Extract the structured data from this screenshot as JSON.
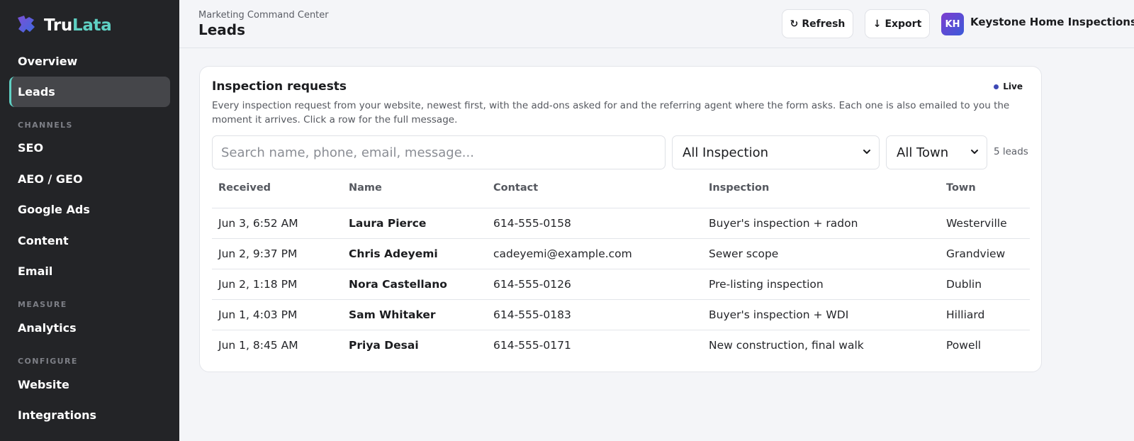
{
  "brand": {
    "name_part1": "Tru",
    "name_part2": "Lata",
    "logo_icon": "puzzle-logo-icon"
  },
  "sidebar": {
    "items_top": [
      {
        "label": "Overview",
        "active": false
      },
      {
        "label": "Leads",
        "active": true
      }
    ],
    "sections": [
      {
        "title": "CHANNELS",
        "items": [
          "SEO",
          "AEO / GEO",
          "Google Ads",
          "Content",
          "Email"
        ]
      },
      {
        "title": "MEASURE",
        "items": [
          "Analytics"
        ]
      },
      {
        "title": "CONFIGURE",
        "items": [
          "Website",
          "Integrations"
        ]
      }
    ]
  },
  "header": {
    "breadcrumb": "Marketing Command Center",
    "title": "Leads",
    "refresh_label": "Refresh",
    "export_label": "Export",
    "refresh_icon": "refresh-icon",
    "export_icon": "download-arrow-icon",
    "avatar_initials": "KH",
    "org_name": "Keystone Home Inspections"
  },
  "card": {
    "title": "Inspection requests",
    "live_label": "Live",
    "description": "Every inspection request from your website, newest first, with the add-ons asked for and the referring agent where the form asks. Each one is also emailed to you the moment it arrives. Click a row for the full message.",
    "search_placeholder": "Search name, phone, email, message...",
    "inspection_filter": "All Inspection",
    "town_filter": "All Town",
    "lead_count": "5 leads"
  },
  "table": {
    "columns": [
      "Received",
      "Name",
      "Contact",
      "Inspection",
      "Town"
    ],
    "rows": [
      [
        "Jun 3, 6:52 AM",
        "Laura Pierce",
        "614-555-0158",
        "Buyer's inspection + radon",
        "Westerville"
      ],
      [
        "Jun 2, 9:37 PM",
        "Chris Adeyemi",
        "cadeyemi@example.com",
        "Sewer scope",
        "Grandview"
      ],
      [
        "Jun 2, 1:18 PM",
        "Nora Castellano",
        "614-555-0126",
        "Pre-listing inspection",
        "Dublin"
      ],
      [
        "Jun 1, 4:03 PM",
        "Sam Whitaker",
        "614-555-0183",
        "Buyer's inspection + WDI",
        "Hilliard"
      ],
      [
        "Jun 1, 8:45 AM",
        "Priya Desai",
        "614-555-0171",
        "New construction, final walk",
        "Powell"
      ]
    ]
  },
  "colors": {
    "accent": "#5fd0c3",
    "sidebar_bg": "#232427",
    "live_dot": "#3e49b5"
  }
}
